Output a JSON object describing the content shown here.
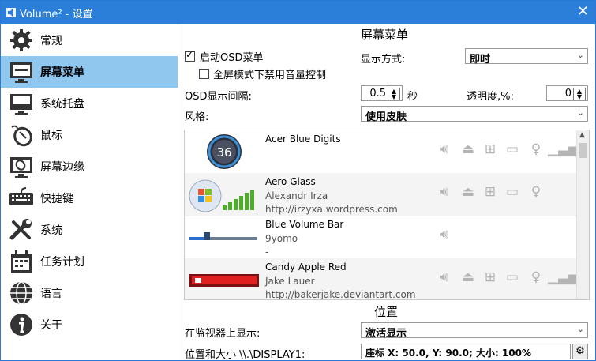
{
  "window": {
    "title": "Volume² - 设置",
    "close_glyph": "✕"
  },
  "sidebar": {
    "active_index": 1,
    "items": [
      {
        "label": "常规",
        "icon": "gear-icon"
      },
      {
        "label": "屏幕菜单",
        "icon": "monitor-icon"
      },
      {
        "label": "系统托盘",
        "icon": "tray-icon"
      },
      {
        "label": "鼠标",
        "icon": "mouse-icon"
      },
      {
        "label": "屏幕边缘",
        "icon": "screen-edge-icon"
      },
      {
        "label": "快捷键",
        "icon": "keyboard-icon"
      },
      {
        "label": "系统",
        "icon": "tools-icon"
      },
      {
        "label": "任务计划",
        "icon": "calendar-icon"
      },
      {
        "label": "语言",
        "icon": "globe-icon"
      },
      {
        "label": "关于",
        "icon": "info-icon"
      }
    ]
  },
  "osd": {
    "section_title": "屏幕菜单",
    "enable_osd_label": "启动OSD菜单",
    "enable_osd_checked": true,
    "disable_fullscreen_label": "全屏模式下禁用音量控制",
    "disable_fullscreen_checked": false,
    "display_mode_label": "显示方式:",
    "display_mode_value": "即时",
    "interval_label": "OSD显示间隔:",
    "interval_value": "0.5",
    "interval_unit": "秒",
    "opacity_label": "透明度,%:",
    "opacity_value": "0",
    "style_label": "风格:",
    "style_value": "使用皮肤"
  },
  "skins": [
    {
      "name": "Acer Blue Digits",
      "author": "",
      "url": "",
      "preview_text": "36"
    },
    {
      "name": "Aero Glass",
      "author": "Alexandr Irza",
      "url": "http://irzyxa.wordpress.com"
    },
    {
      "name": "Blue Volume Bar",
      "author": "9yomo",
      "url": "-"
    },
    {
      "name": "Candy Apple Red",
      "author": "Jake Lauer",
      "url": "http://bakerjake.deviantart.com"
    }
  ],
  "position": {
    "section_title": "位置",
    "monitor_label": "在监视器上显示:",
    "monitor_value": "激活显示",
    "pos_size_label": "位置和大小 \\\\.\\DISPLAY1:",
    "pos_size_value": "座标 X: 50.0, Y: 90.0; 大小: 100%"
  },
  "colors": {
    "titlebar": "#2b7fd8",
    "sidebar_active": "#90c7ef",
    "capability_icon": "#b4b4b4"
  }
}
